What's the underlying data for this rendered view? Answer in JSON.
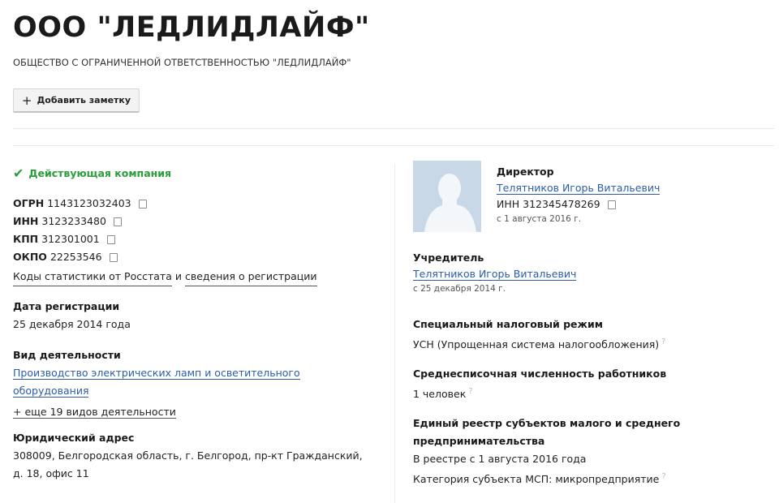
{
  "header": {
    "title": "ООО \"ЛЕДЛИДЛАЙФ\"",
    "full_name": "ОБЩЕСТВО С ОГРАНИЧЕННОЙ ОТВЕТСТВЕННОСТЬЮ \"ЛЕДЛИДЛАЙФ\"",
    "note_button": "Добавить заметку"
  },
  "left": {
    "status": "Действующая компания",
    "codes": [
      {
        "label": "ОГРН",
        "value": "1143123032403"
      },
      {
        "label": "ИНН",
        "value": "3123233480"
      },
      {
        "label": "КПП",
        "value": "312301001"
      },
      {
        "label": "ОКПО",
        "value": "22253546"
      }
    ],
    "stats_link": "Коды статистики от Росстата",
    "stats_and": "и",
    "reg_link": "сведения о регистрации",
    "reg_date_label": "Дата регистрации",
    "reg_date": "25 декабря 2014 года",
    "activity_label": "Вид деятельности",
    "activity_line1": "Производство электрических ламп и осветительного",
    "activity_line2": "оборудования",
    "more_activities": "+ еще 19 видов деятельности",
    "address_label": "Юридический адрес",
    "address_line1": "308009, Белгородская область, г. Белгород, пр-кт Гражданский,",
    "address_line2": "д. 18, офис 11"
  },
  "right": {
    "director_label": "Директор",
    "director_name": "Телятников Игорь Витальевич",
    "director_inn": "ИНН 312345478269",
    "director_since": "с 1 августа 2016 г.",
    "founder_label": "Учредитель",
    "founder_name": "Телятников Игорь Витальевич",
    "founder_since": "с 25 декабря 2014 г.",
    "tax_label": "Специальный налоговый режим",
    "tax_value": "УСН (Упрощенная система налогообложения)",
    "employees_label": "Среднесписочная численность работников",
    "employees_value": "1 человек",
    "registry_label_line1": "Единый реестр субъектов малого и среднего",
    "registry_label_line2": "предпринимательства",
    "registry_since": "В реестре с 1 августа 2016 года",
    "registry_category": "Категория субъекта МСП: микропредприятие"
  },
  "icons": {
    "copy": "copy-icon",
    "help": "question-mark-icon",
    "check": "check-icon",
    "plus": "plus-icon",
    "avatar": "person-silhouette"
  },
  "colors": {
    "status_green": "#2a9d3c",
    "link_blue": "#2a5da8",
    "avatar_bg": "#c9d8e6"
  }
}
